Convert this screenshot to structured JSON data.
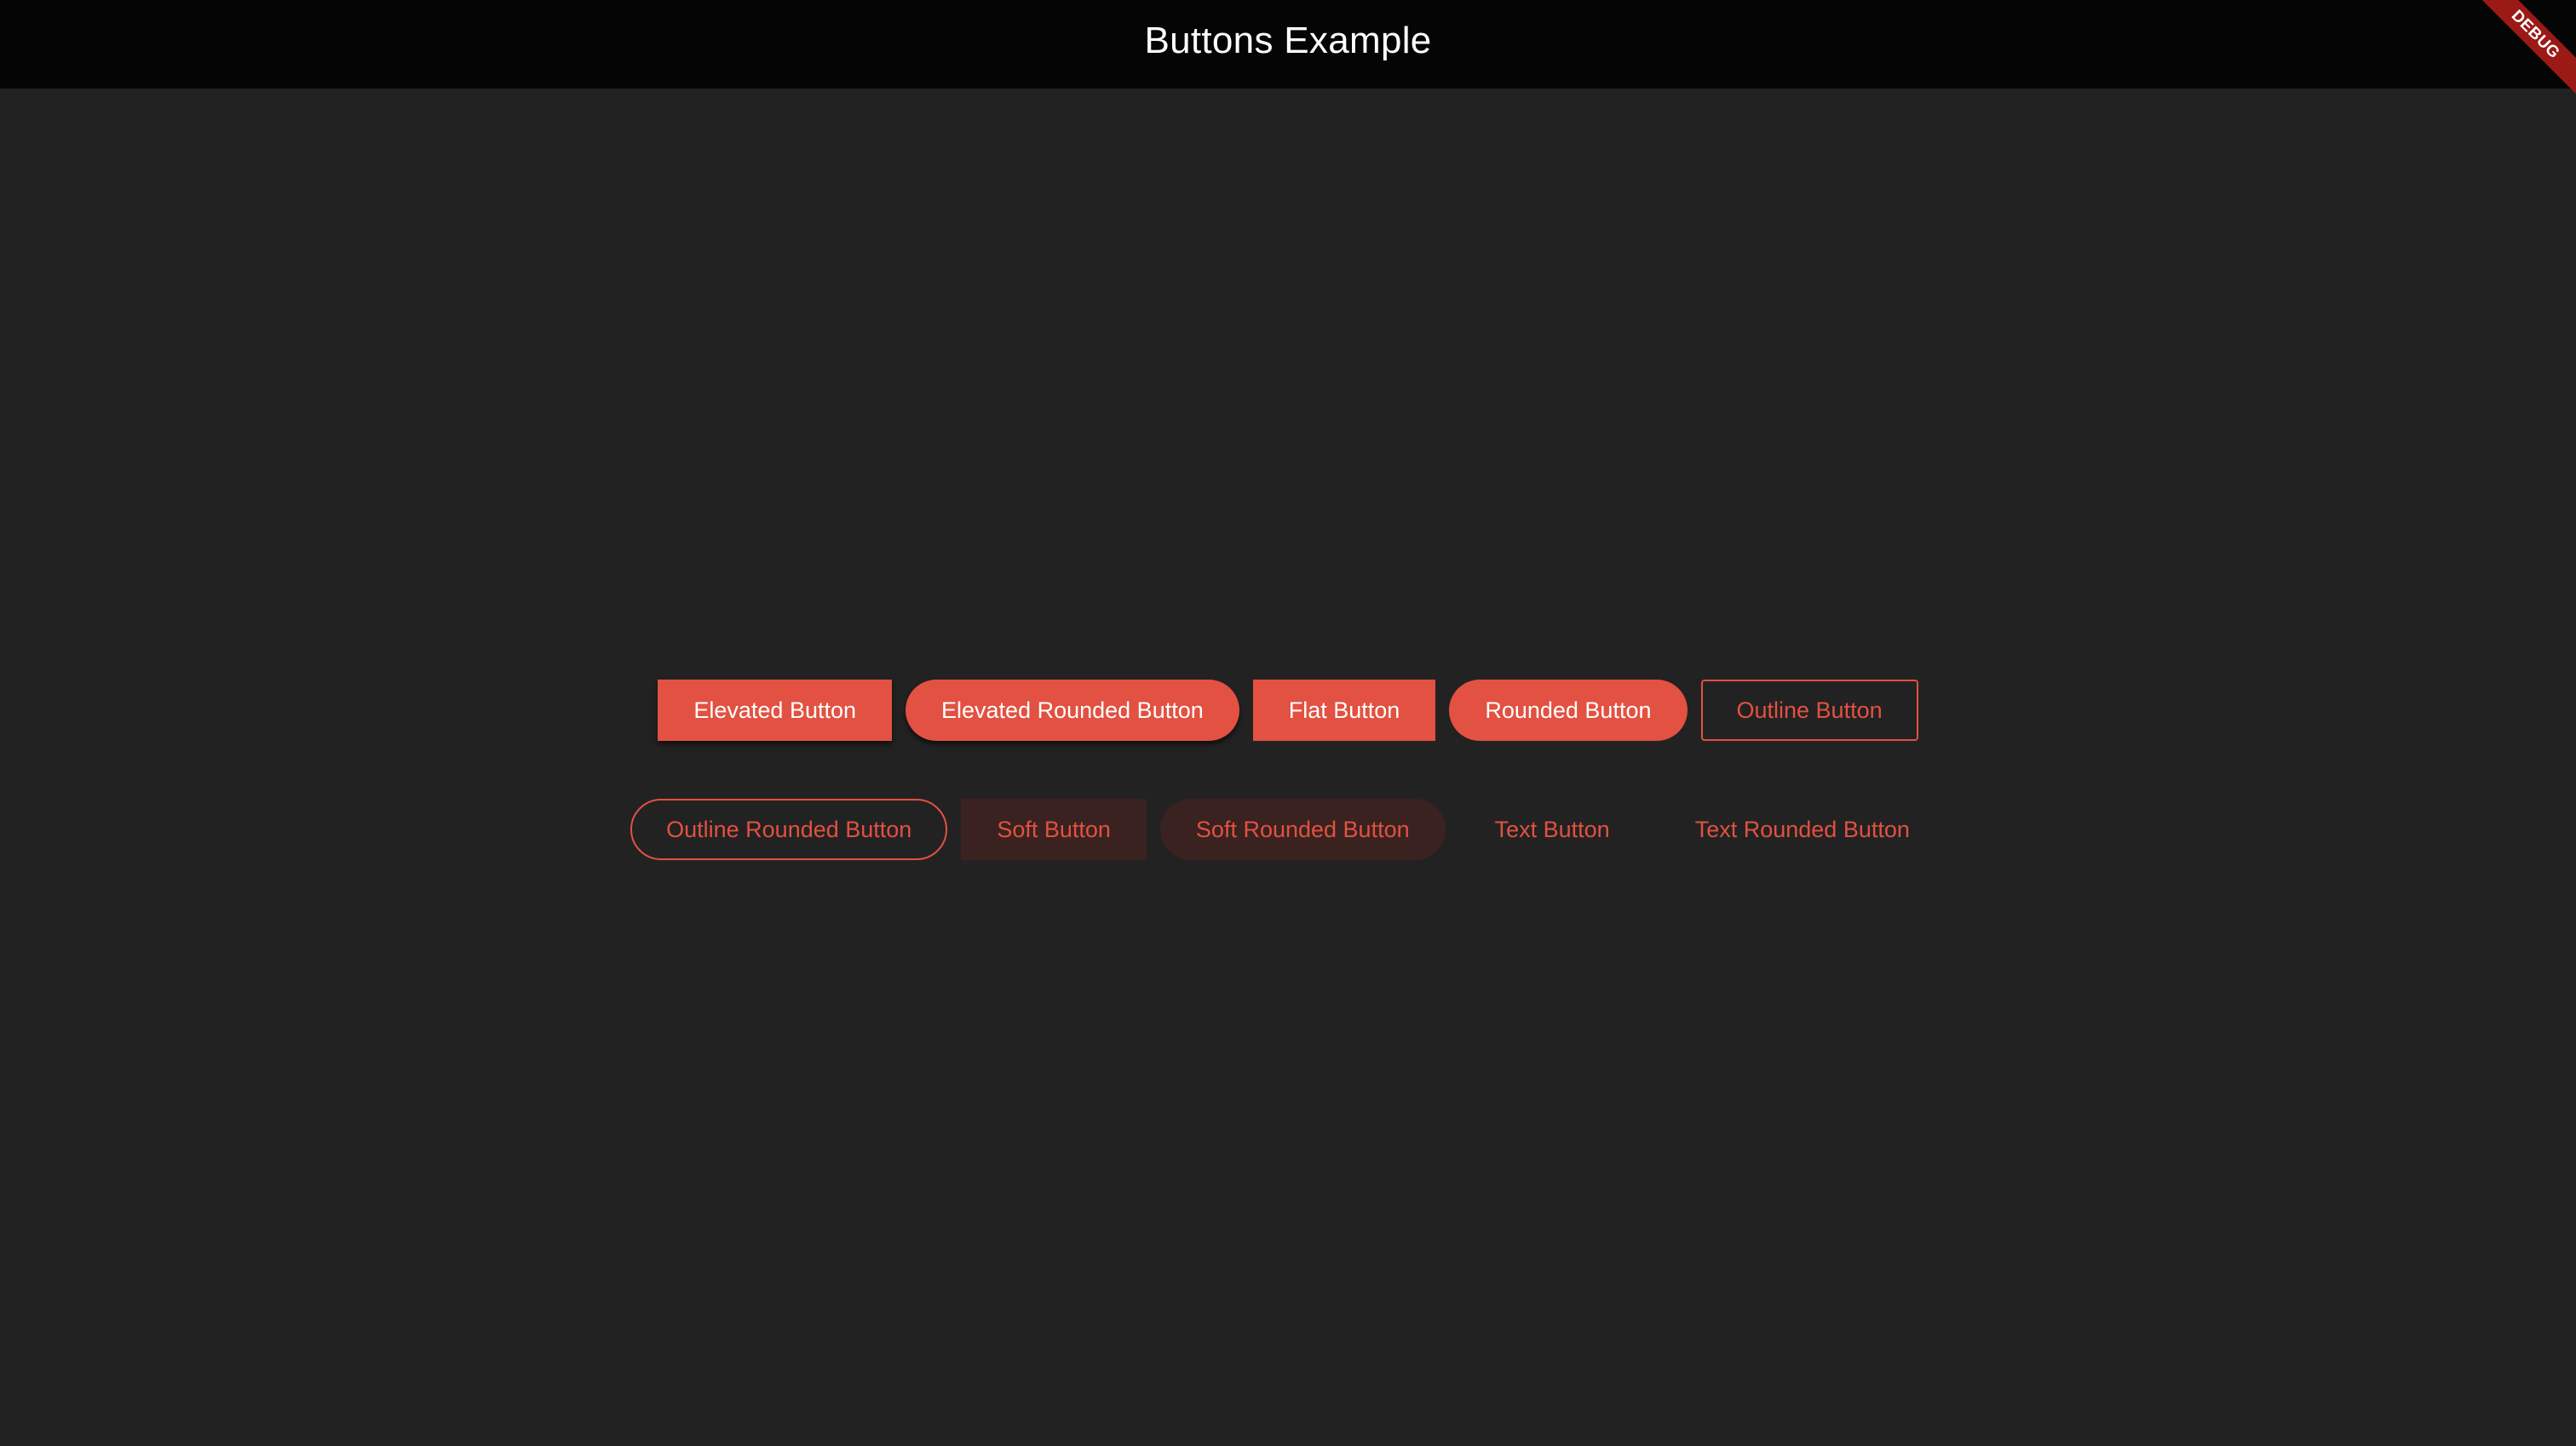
{
  "app_bar": {
    "title": "Buttons Example"
  },
  "debug_banner": {
    "label": "DEBUG"
  },
  "colors": {
    "accent": "#e25141",
    "background": "#222222",
    "app_bar": "#050505",
    "soft_fill": "#392220",
    "debug": "#9c1a16"
  },
  "buttons": {
    "row1": [
      {
        "label": "Elevated Button"
      },
      {
        "label": "Elevated Rounded Button"
      },
      {
        "label": "Flat Button"
      },
      {
        "label": "Rounded Button"
      },
      {
        "label": "Outline Button"
      }
    ],
    "row2": [
      {
        "label": "Outline Rounded Button"
      },
      {
        "label": "Soft Button"
      },
      {
        "label": "Soft Rounded Button"
      },
      {
        "label": "Text Button"
      },
      {
        "label": "Text Rounded Button"
      }
    ]
  }
}
